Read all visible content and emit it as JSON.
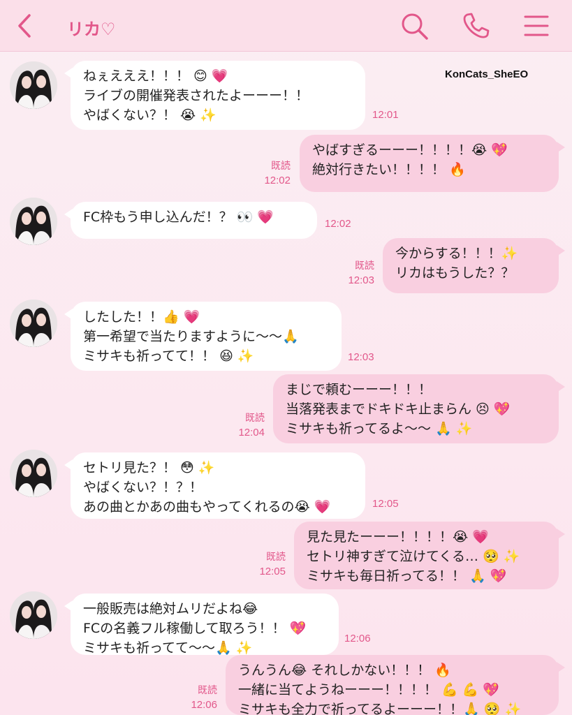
{
  "header": {
    "title": "リカ♡",
    "back_icon": "chevron-left-icon",
    "search_icon": "search-icon",
    "call_icon": "phone-icon",
    "menu_icon": "menu-icon",
    "accent_color": "#e2578a",
    "background_color": "#fbdfe9"
  },
  "watermark": "KonCats_SheEO",
  "read_label": "既読",
  "messages": [
    {
      "side": "in",
      "lines": [
        "ねぇえええ！！！ 😊 💗",
        "ライブの開催発表されたよーーー！！",
        "やばくない？！ 😭 ✨"
      ],
      "time": "12:01"
    },
    {
      "side": "out",
      "lines": [
        "やばすぎるーーー！！！！😭 💖",
        "絶対行きたい！！！！ 🔥"
      ],
      "time": "12:02",
      "read": "既読"
    },
    {
      "side": "in",
      "lines": [
        "FC枠もう申し込んだ！？ 👀 💗"
      ],
      "time": "12:02"
    },
    {
      "side": "out",
      "lines": [
        "今からする！！！✨",
        "リカはもうした？？"
      ],
      "time": "12:03",
      "read": "既読"
    },
    {
      "side": "in",
      "lines": [
        "したした！！👍 💗",
        "第一希望で当たりますように〜〜🙏",
        "ミサキも祈ってて！！ 😆 ✨"
      ],
      "time": "12:03"
    },
    {
      "side": "out",
      "lines": [
        "まじで頼むーーー！！！",
        "当落発表までドキドキ止まらん 😣 💖",
        "ミサキも祈ってるよ〜〜 🙏 ✨"
      ],
      "time": "12:04",
      "read": "既読"
    },
    {
      "side": "in",
      "lines": [
        "セトリ見た？！ 😳 ✨",
        "やばくない？！？！",
        "あの曲とかあの曲もやってくれるの😭 💗"
      ],
      "time": "12:05"
    },
    {
      "side": "out",
      "lines": [
        "見た見たーーー！！！！😭 💗",
        "セトリ神すぎて泣けてくる… 🥺 ✨",
        "ミサキも毎日祈ってる！！ 🙏 💖"
      ],
      "time": "12:05",
      "read": "既読"
    },
    {
      "side": "in",
      "lines": [
        "一般販売は絶対ムリだよね😂",
        "FCの名義フル稼働して取ろう！！ 💖",
        "ミサキも祈ってて〜〜🙏 ✨"
      ],
      "time": "12:06"
    },
    {
      "side": "out",
      "lines": [
        "うんうん😂 それしかない！！！ 🔥",
        "一緒に当てようねーーー！！！！ 💪 💪 💖",
        "ミサキも全力で祈ってるよーーー！！🙏 🥺 ✨"
      ],
      "time": "12:06",
      "read": "既読"
    }
  ]
}
